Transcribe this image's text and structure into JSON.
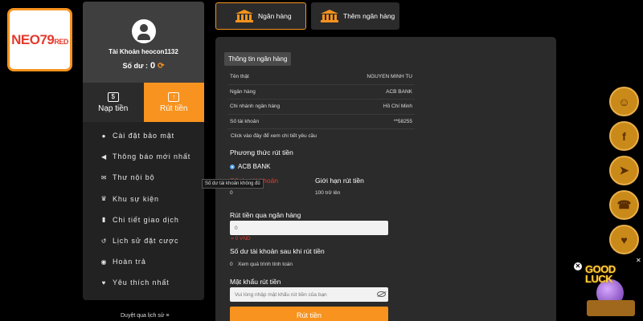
{
  "logo": {
    "main": "NEO79",
    "suffix": "RED"
  },
  "profile": {
    "account": "Tài Khoản heocon1132",
    "balance_label": "Số dư :",
    "balance_value": "0"
  },
  "actions": {
    "deposit": "Nạp tiền",
    "withdraw": "Rút tiền"
  },
  "menu": [
    {
      "label": "Cài đặt bảo mật",
      "icon": "user-cog-icon"
    },
    {
      "label": "Thông báo mới nhất",
      "icon": "megaphone-icon"
    },
    {
      "label": "Thư nội bộ",
      "icon": "envelope-icon"
    },
    {
      "label": "Khu sự kiện",
      "icon": "trophy-icon"
    },
    {
      "label": "Chi tiết giao dịch",
      "icon": "clipboard-icon"
    },
    {
      "label": "Lịch sử đặt cược",
      "icon": "history-icon"
    },
    {
      "label": "Hoàn trả",
      "icon": "coin-icon"
    },
    {
      "label": "Yêu thích nhất",
      "icon": "heart-icon"
    }
  ],
  "history_link": "Duyệt qua lịch sử ≡",
  "tabs": {
    "bank": "Ngân hàng",
    "add_bank": "Thêm ngân hàng"
  },
  "bank_info": {
    "badge": "Thông tin ngân hàng",
    "rows": [
      {
        "label": "Tên thật",
        "value": "NGUYEN MINH TU"
      },
      {
        "label": "Ngân hàng",
        "value": "ACB BANK"
      },
      {
        "label": "Chi nhánh ngân hàng",
        "value": "Hồ Chí Minh"
      },
      {
        "label": "Số tài khoản",
        "value": "**58255"
      }
    ],
    "click_note": "Click vào đây để xem chi tiết yêu cầu"
  },
  "withdraw": {
    "method_title": "Phương thức rút tiền",
    "method_option": "ACB BANK",
    "balance_label": "Số dư tài khoản",
    "balance_value": "0",
    "limit_label": "Giới hạn rút tiền",
    "limit_value": "100 trở lên",
    "amount_title": "Rút tiền qua ngân hàng",
    "amount_value": "0",
    "amount_vnd": "= 0 VND",
    "after_title": "Số dư tài khoản sau khi rút tiền",
    "after_value": "0",
    "after_note": "Xem quá trình tính toán",
    "password_title": "Mật khẩu rút tiền",
    "password_placeholder": "Vui lòng nhập mật khẩu rút tiền của bạn",
    "submit": "Rút tiền"
  },
  "tooltip": "Số dư tài khoản không đủ",
  "promo": {
    "text": "GOOD LUCK"
  }
}
